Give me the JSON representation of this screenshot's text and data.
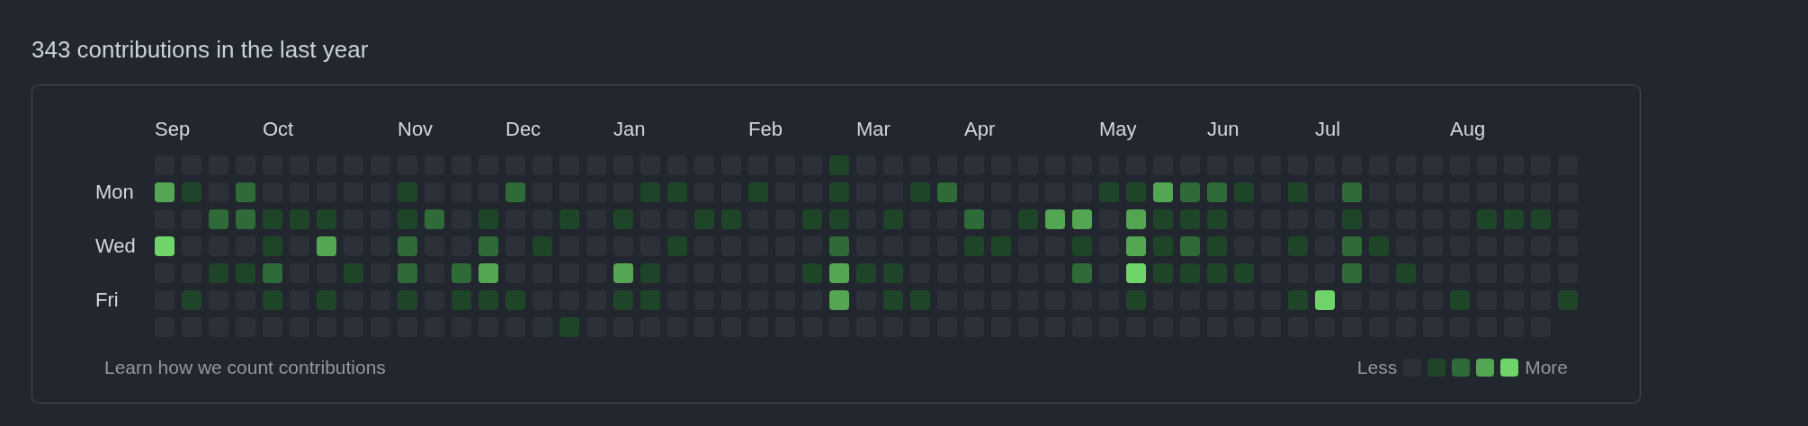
{
  "title": "343 contributions in the last year",
  "weekday_labels": [
    "Mon",
    "Wed",
    "Fri"
  ],
  "weeks": [
    {
      "month": "Sep",
      "days": [
        {
          "color": "#2c3139"
        },
        {
          "color": "#55a652"
        },
        {
          "color": "#2c3139"
        },
        {
          "color": "#6fd46a"
        },
        {
          "color": "#2c3139"
        },
        {
          "color": "#2c3139"
        },
        {
          "color": "#2c3139"
        }
      ]
    },
    {
      "days": [
        {
          "color": "#2c3139"
        },
        {
          "color": "#1f4529"
        },
        {
          "color": "#2c3139"
        },
        {
          "color": "#2c3139"
        },
        {
          "color": "#2c3139"
        },
        {
          "color": "#1f4529"
        },
        {
          "color": "#2c3139"
        }
      ]
    },
    {
      "days": [
        {
          "color": "#2c3139"
        },
        {
          "color": "#2c3139"
        },
        {
          "color": "#2e6b38"
        },
        {
          "color": "#2c3139"
        },
        {
          "color": "#1f4529"
        },
        {
          "color": "#2c3139"
        },
        {
          "color": "#2c3139"
        }
      ]
    },
    {
      "days": [
        {
          "color": "#2c3139"
        },
        {
          "color": "#2e6b38"
        },
        {
          "color": "#2e6b38"
        },
        {
          "color": "#2c3139"
        },
        {
          "color": "#1f4529"
        },
        {
          "color": "#2c3139"
        },
        {
          "color": "#2c3139"
        }
      ]
    },
    {
      "month": "Oct",
      "days": [
        {
          "color": "#2c3139"
        },
        {
          "color": "#2c3139"
        },
        {
          "color": "#1f4529"
        },
        {
          "color": "#1f4529"
        },
        {
          "color": "#2e6b38"
        },
        {
          "color": "#1f4529"
        },
        {
          "color": "#2c3139"
        }
      ]
    },
    {
      "days": [
        {
          "color": "#2c3139"
        },
        {
          "color": "#2c3139"
        },
        {
          "color": "#1f4529"
        },
        {
          "color": "#2c3139"
        },
        {
          "color": "#2c3139"
        },
        {
          "color": "#2c3139"
        },
        {
          "color": "#2c3139"
        }
      ]
    },
    {
      "days": [
        {
          "color": "#2c3139"
        },
        {
          "color": "#2c3139"
        },
        {
          "color": "#1f4529"
        },
        {
          "color": "#55a652"
        },
        {
          "color": "#2c3139"
        },
        {
          "color": "#1f4529"
        },
        {
          "color": "#2c3139"
        }
      ]
    },
    {
      "days": [
        {
          "color": "#2c3139"
        },
        {
          "color": "#2c3139"
        },
        {
          "color": "#2c3139"
        },
        {
          "color": "#2c3139"
        },
        {
          "color": "#1f4529"
        },
        {
          "color": "#2c3139"
        },
        {
          "color": "#2c3139"
        }
      ]
    },
    {
      "days": [
        {
          "color": "#2c3139"
        },
        {
          "color": "#2c3139"
        },
        {
          "color": "#2c3139"
        },
        {
          "color": "#2c3139"
        },
        {
          "color": "#2c3139"
        },
        {
          "color": "#2c3139"
        },
        {
          "color": "#2c3139"
        }
      ]
    },
    {
      "month": "Nov",
      "days": [
        {
          "color": "#2c3139"
        },
        {
          "color": "#1f4529"
        },
        {
          "color": "#1f4529"
        },
        {
          "color": "#2e6b38"
        },
        {
          "color": "#2e6b38"
        },
        {
          "color": "#1f4529"
        },
        {
          "color": "#2c3139"
        }
      ]
    },
    {
      "days": [
        {
          "color": "#2c3139"
        },
        {
          "color": "#2c3139"
        },
        {
          "color": "#2e6b38"
        },
        {
          "color": "#2c3139"
        },
        {
          "color": "#2c3139"
        },
        {
          "color": "#2c3139"
        },
        {
          "color": "#2c3139"
        }
      ]
    },
    {
      "days": [
        {
          "color": "#2c3139"
        },
        {
          "color": "#2c3139"
        },
        {
          "color": "#2c3139"
        },
        {
          "color": "#2c3139"
        },
        {
          "color": "#2e6b38"
        },
        {
          "color": "#1f4529"
        },
        {
          "color": "#2c3139"
        }
      ]
    },
    {
      "days": [
        {
          "color": "#2c3139"
        },
        {
          "color": "#2c3139"
        },
        {
          "color": "#1f4529"
        },
        {
          "color": "#2e6b38"
        },
        {
          "color": "#55a652"
        },
        {
          "color": "#1f4529"
        },
        {
          "color": "#2c3139"
        }
      ]
    },
    {
      "month": "Dec",
      "days": [
        {
          "color": "#2c3139"
        },
        {
          "color": "#2e6b38"
        },
        {
          "color": "#2c3139"
        },
        {
          "color": "#2c3139"
        },
        {
          "color": "#2c3139"
        },
        {
          "color": "#1f4529"
        },
        {
          "color": "#2c3139"
        }
      ]
    },
    {
      "days": [
        {
          "color": "#2c3139"
        },
        {
          "color": "#2c3139"
        },
        {
          "color": "#2c3139"
        },
        {
          "color": "#1f4529"
        },
        {
          "color": "#2c3139"
        },
        {
          "color": "#2c3139"
        },
        {
          "color": "#2c3139"
        }
      ]
    },
    {
      "days": [
        {
          "color": "#2c3139"
        },
        {
          "color": "#2c3139"
        },
        {
          "color": "#1f4529"
        },
        {
          "color": "#2c3139"
        },
        {
          "color": "#2c3139"
        },
        {
          "color": "#2c3139"
        },
        {
          "color": "#1f4529"
        }
      ]
    },
    {
      "days": [
        {
          "color": "#2c3139"
        },
        {
          "color": "#2c3139"
        },
        {
          "color": "#2c3139"
        },
        {
          "color": "#2c3139"
        },
        {
          "color": "#2c3139"
        },
        {
          "color": "#2c3139"
        },
        {
          "color": "#2c3139"
        }
      ]
    },
    {
      "month": "Jan",
      "days": [
        {
          "color": "#2c3139"
        },
        {
          "color": "#2c3139"
        },
        {
          "color": "#1f4529"
        },
        {
          "color": "#2c3139"
        },
        {
          "color": "#55a652"
        },
        {
          "color": "#1f4529"
        },
        {
          "color": "#2c3139"
        }
      ]
    },
    {
      "days": [
        {
          "color": "#2c3139"
        },
        {
          "color": "#1f4529"
        },
        {
          "color": "#2c3139"
        },
        {
          "color": "#2c3139"
        },
        {
          "color": "#1f4529"
        },
        {
          "color": "#1f4529"
        },
        {
          "color": "#2c3139"
        }
      ]
    },
    {
      "days": [
        {
          "color": "#2c3139"
        },
        {
          "color": "#1f4529"
        },
        {
          "color": "#2c3139"
        },
        {
          "color": "#1f4529"
        },
        {
          "color": "#2c3139"
        },
        {
          "color": "#2c3139"
        },
        {
          "color": "#2c3139"
        }
      ]
    },
    {
      "days": [
        {
          "color": "#2c3139"
        },
        {
          "color": "#2c3139"
        },
        {
          "color": "#1f4529"
        },
        {
          "color": "#2c3139"
        },
        {
          "color": "#2c3139"
        },
        {
          "color": "#2c3139"
        },
        {
          "color": "#2c3139"
        }
      ]
    },
    {
      "days": [
        {
          "color": "#2c3139"
        },
        {
          "color": "#2c3139"
        },
        {
          "color": "#1f4529"
        },
        {
          "color": "#2c3139"
        },
        {
          "color": "#2c3139"
        },
        {
          "color": "#2c3139"
        },
        {
          "color": "#2c3139"
        }
      ]
    },
    {
      "month": "Feb",
      "days": [
        {
          "color": "#2c3139"
        },
        {
          "color": "#1f4529"
        },
        {
          "color": "#2c3139"
        },
        {
          "color": "#2c3139"
        },
        {
          "color": "#2c3139"
        },
        {
          "color": "#2c3139"
        },
        {
          "color": "#2c3139"
        }
      ]
    },
    {
      "days": [
        {
          "color": "#2c3139"
        },
        {
          "color": "#2c3139"
        },
        {
          "color": "#2c3139"
        },
        {
          "color": "#2c3139"
        },
        {
          "color": "#2c3139"
        },
        {
          "color": "#2c3139"
        },
        {
          "color": "#2c3139"
        }
      ]
    },
    {
      "days": [
        {
          "color": "#2c3139"
        },
        {
          "color": "#2c3139"
        },
        {
          "color": "#1f4529"
        },
        {
          "color": "#2c3139"
        },
        {
          "color": "#1f4529"
        },
        {
          "color": "#2c3139"
        },
        {
          "color": "#2c3139"
        }
      ]
    },
    {
      "days": [
        {
          "color": "#1f4529"
        },
        {
          "color": "#1f4529"
        },
        {
          "color": "#1f4529"
        },
        {
          "color": "#2e6b38"
        },
        {
          "color": "#55a652"
        },
        {
          "color": "#55a652"
        },
        {
          "color": "#2c3139"
        }
      ]
    },
    {
      "month": "Mar",
      "days": [
        {
          "color": "#2c3139"
        },
        {
          "color": "#2c3139"
        },
        {
          "color": "#2c3139"
        },
        {
          "color": "#2c3139"
        },
        {
          "color": "#1f4529"
        },
        {
          "color": "#2c3139"
        },
        {
          "color": "#2c3139"
        }
      ]
    },
    {
      "days": [
        {
          "color": "#2c3139"
        },
        {
          "color": "#2c3139"
        },
        {
          "color": "#1f4529"
        },
        {
          "color": "#2c3139"
        },
        {
          "color": "#1f4529"
        },
        {
          "color": "#1f4529"
        },
        {
          "color": "#2c3139"
        }
      ]
    },
    {
      "days": [
        {
          "color": "#2c3139"
        },
        {
          "color": "#1f4529"
        },
        {
          "color": "#2c3139"
        },
        {
          "color": "#2c3139"
        },
        {
          "color": "#2c3139"
        },
        {
          "color": "#1f4529"
        },
        {
          "color": "#2c3139"
        }
      ]
    },
    {
      "days": [
        {
          "color": "#2c3139"
        },
        {
          "color": "#2e6b38"
        },
        {
          "color": "#2c3139"
        },
        {
          "color": "#2c3139"
        },
        {
          "color": "#2c3139"
        },
        {
          "color": "#2c3139"
        },
        {
          "color": "#2c3139"
        }
      ]
    },
    {
      "month": "Apr",
      "days": [
        {
          "color": "#2c3139"
        },
        {
          "color": "#2c3139"
        },
        {
          "color": "#2e6b38"
        },
        {
          "color": "#1f4529"
        },
        {
          "color": "#2c3139"
        },
        {
          "color": "#2c3139"
        },
        {
          "color": "#2c3139"
        }
      ]
    },
    {
      "days": [
        {
          "color": "#2c3139"
        },
        {
          "color": "#2c3139"
        },
        {
          "color": "#2c3139"
        },
        {
          "color": "#1f4529"
        },
        {
          "color": "#2c3139"
        },
        {
          "color": "#2c3139"
        },
        {
          "color": "#2c3139"
        }
      ]
    },
    {
      "days": [
        {
          "color": "#2c3139"
        },
        {
          "color": "#2c3139"
        },
        {
          "color": "#1f4529"
        },
        {
          "color": "#2c3139"
        },
        {
          "color": "#2c3139"
        },
        {
          "color": "#2c3139"
        },
        {
          "color": "#2c3139"
        }
      ]
    },
    {
      "days": [
        {
          "color": "#2c3139"
        },
        {
          "color": "#2c3139"
        },
        {
          "color": "#55a652"
        },
        {
          "color": "#2c3139"
        },
        {
          "color": "#2c3139"
        },
        {
          "color": "#2c3139"
        },
        {
          "color": "#2c3139"
        }
      ]
    },
    {
      "days": [
        {
          "color": "#2c3139"
        },
        {
          "color": "#2c3139"
        },
        {
          "color": "#55a652"
        },
        {
          "color": "#1f4529"
        },
        {
          "color": "#2e6b38"
        },
        {
          "color": "#2c3139"
        },
        {
          "color": "#2c3139"
        }
      ]
    },
    {
      "month": "May",
      "days": [
        {
          "color": "#2c3139"
        },
        {
          "color": "#1f4529"
        },
        {
          "color": "#2c3139"
        },
        {
          "color": "#2c3139"
        },
        {
          "color": "#2c3139"
        },
        {
          "color": "#2c3139"
        },
        {
          "color": "#2c3139"
        }
      ]
    },
    {
      "days": [
        {
          "color": "#2c3139"
        },
        {
          "color": "#1f4529"
        },
        {
          "color": "#55a652"
        },
        {
          "color": "#55a652"
        },
        {
          "color": "#6fd46a"
        },
        {
          "color": "#1f4529"
        },
        {
          "color": "#2c3139"
        }
      ]
    },
    {
      "days": [
        {
          "color": "#2c3139"
        },
        {
          "color": "#55a652"
        },
        {
          "color": "#1f4529"
        },
        {
          "color": "#1f4529"
        },
        {
          "color": "#1f4529"
        },
        {
          "color": "#2c3139"
        },
        {
          "color": "#2c3139"
        }
      ]
    },
    {
      "days": [
        {
          "color": "#2c3139"
        },
        {
          "color": "#2e6b38"
        },
        {
          "color": "#1f4529"
        },
        {
          "color": "#2e6b38"
        },
        {
          "color": "#1f4529"
        },
        {
          "color": "#2c3139"
        },
        {
          "color": "#2c3139"
        }
      ]
    },
    {
      "month": "Jun",
      "days": [
        {
          "color": "#2c3139"
        },
        {
          "color": "#2e6b38"
        },
        {
          "color": "#1f4529"
        },
        {
          "color": "#1f4529"
        },
        {
          "color": "#1f4529"
        },
        {
          "color": "#2c3139"
        },
        {
          "color": "#2c3139"
        }
      ]
    },
    {
      "days": [
        {
          "color": "#2c3139"
        },
        {
          "color": "#1f4529"
        },
        {
          "color": "#2c3139"
        },
        {
          "color": "#2c3139"
        },
        {
          "color": "#1f4529"
        },
        {
          "color": "#2c3139"
        },
        {
          "color": "#2c3139"
        }
      ]
    },
    {
      "days": [
        {
          "color": "#2c3139"
        },
        {
          "color": "#2c3139"
        },
        {
          "color": "#2c3139"
        },
        {
          "color": "#2c3139"
        },
        {
          "color": "#2c3139"
        },
        {
          "color": "#2c3139"
        },
        {
          "color": "#2c3139"
        }
      ]
    },
    {
      "days": [
        {
          "color": "#2c3139"
        },
        {
          "color": "#1f4529"
        },
        {
          "color": "#2c3139"
        },
        {
          "color": "#1f4529"
        },
        {
          "color": "#2c3139"
        },
        {
          "color": "#1f4529"
        },
        {
          "color": "#2c3139"
        }
      ]
    },
    {
      "month": "Jul",
      "days": [
        {
          "color": "#2c3139"
        },
        {
          "color": "#2c3139"
        },
        {
          "color": "#2c3139"
        },
        {
          "color": "#2c3139"
        },
        {
          "color": "#2c3139"
        },
        {
          "color": "#6fd46a"
        },
        {
          "color": "#2c3139"
        }
      ]
    },
    {
      "days": [
        {
          "color": "#2c3139"
        },
        {
          "color": "#2e6b38"
        },
        {
          "color": "#1f4529"
        },
        {
          "color": "#2e6b38"
        },
        {
          "color": "#2e6b38"
        },
        {
          "color": "#2c3139"
        },
        {
          "color": "#2c3139"
        }
      ]
    },
    {
      "days": [
        {
          "color": "#2c3139"
        },
        {
          "color": "#2c3139"
        },
        {
          "color": "#2c3139"
        },
        {
          "color": "#1f4529"
        },
        {
          "color": "#2c3139"
        },
        {
          "color": "#2c3139"
        },
        {
          "color": "#2c3139"
        }
      ]
    },
    {
      "days": [
        {
          "color": "#2c3139"
        },
        {
          "color": "#2c3139"
        },
        {
          "color": "#2c3139"
        },
        {
          "color": "#2c3139"
        },
        {
          "color": "#1f4529"
        },
        {
          "color": "#2c3139"
        },
        {
          "color": "#2c3139"
        }
      ]
    },
    {
      "days": [
        {
          "color": "#2c3139"
        },
        {
          "color": "#2c3139"
        },
        {
          "color": "#2c3139"
        },
        {
          "color": "#2c3139"
        },
        {
          "color": "#2c3139"
        },
        {
          "color": "#2c3139"
        },
        {
          "color": "#2c3139"
        }
      ]
    },
    {
      "month": "Aug",
      "days": [
        {
          "color": "#2c3139"
        },
        {
          "color": "#2c3139"
        },
        {
          "color": "#2c3139"
        },
        {
          "color": "#2c3139"
        },
        {
          "color": "#2c3139"
        },
        {
          "color": "#1f4529"
        },
        {
          "color": "#2c3139"
        }
      ]
    },
    {
      "days": [
        {
          "color": "#2c3139"
        },
        {
          "color": "#2c3139"
        },
        {
          "color": "#1f4529"
        },
        {
          "color": "#2c3139"
        },
        {
          "color": "#2c3139"
        },
        {
          "color": "#2c3139"
        },
        {
          "color": "#2c3139"
        }
      ]
    },
    {
      "days": [
        {
          "color": "#2c3139"
        },
        {
          "color": "#2c3139"
        },
        {
          "color": "#1f4529"
        },
        {
          "color": "#2c3139"
        },
        {
          "color": "#2c3139"
        },
        {
          "color": "#2c3139"
        },
        {
          "color": "#2c3139"
        }
      ]
    },
    {
      "days": [
        {
          "color": "#2c3139"
        },
        {
          "color": "#2c3139"
        },
        {
          "color": "#1f4529"
        },
        {
          "color": "#2c3139"
        },
        {
          "color": "#2c3139"
        },
        {
          "color": "#2c3139"
        },
        {
          "color": "#2c3139"
        }
      ]
    },
    {
      "days": [
        {
          "color": "#2c3139"
        },
        {
          "color": "#2c3139"
        },
        {
          "color": "#2c3139"
        },
        {
          "color": "#2c3139"
        },
        {
          "color": "#2c3139"
        },
        {
          "color": "#1f4529"
        }
      ]
    }
  ],
  "footer": {
    "link": "Learn how we count contributions",
    "less": "Less",
    "more": "More",
    "legend": [
      {
        "color": "#2c3139"
      },
      {
        "color": "#1f4529"
      },
      {
        "color": "#2e6b38"
      },
      {
        "color": "#55a652"
      },
      {
        "color": "#6fd46a"
      }
    ]
  }
}
